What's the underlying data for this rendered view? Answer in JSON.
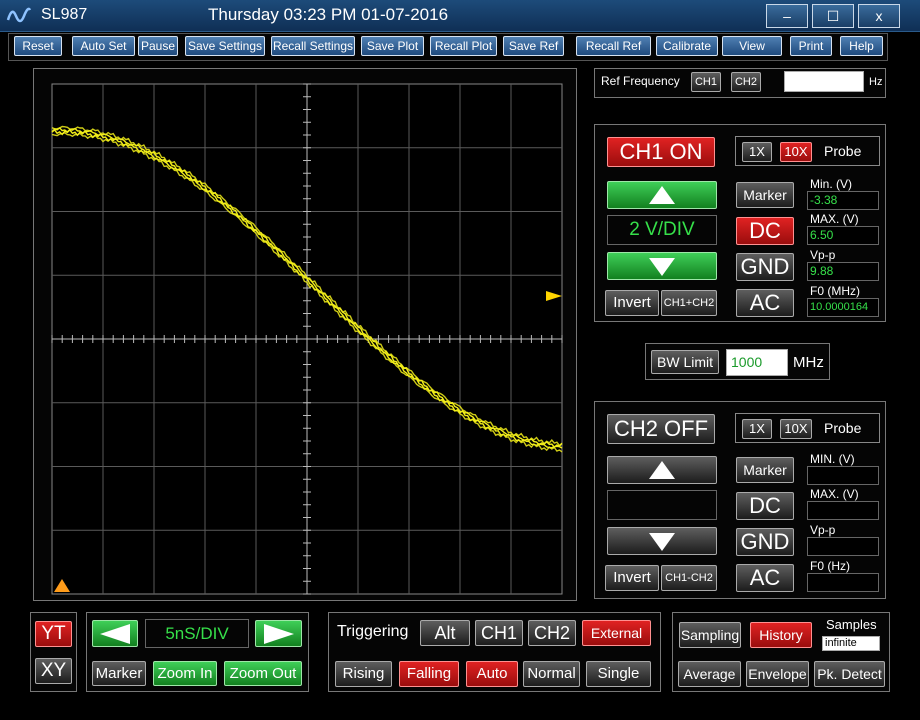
{
  "titlebar": {
    "app_name": "SL987",
    "datetime": "Thursday  03:23 PM   01-07-2016",
    "minimize": "–",
    "maximize": "☐",
    "close": "x"
  },
  "toolbar": [
    "Reset",
    "Auto Set",
    "Pause",
    "Save Settings",
    "Recall Settings",
    "Save Plot",
    "Recall Plot",
    "Save Ref",
    "Recall Ref",
    "Calibrate",
    "View",
    "Print",
    "Help"
  ],
  "ref": {
    "label": "Ref Frequency",
    "ch1": "CH1",
    "ch2": "CH2",
    "value": "",
    "unit": "Hz"
  },
  "ch1": {
    "state": "CH1 ON",
    "probe_1x": "1X",
    "probe_10x": "10X",
    "probe_label": "Probe",
    "volts_div": "2 V/DIV",
    "marker": "Marker",
    "dc": "DC",
    "gnd": "GND",
    "ac": "AC",
    "invert": "Invert",
    "math": "CH1+CH2",
    "min_label": "Min. (V)",
    "min_value": "-3.38",
    "max_label": "MAX. (V)",
    "max_value": "6.50",
    "vpp_label": "Vp-p",
    "vpp_value": "9.88",
    "f0_label": "F0 (MHz)",
    "f0_value": "10.0000164"
  },
  "bw": {
    "label": "BW Limit",
    "value": "1000",
    "unit": "MHz"
  },
  "ch2": {
    "state": "CH2 OFF",
    "probe_1x": "1X",
    "probe_10x": "10X",
    "probe_label": "Probe",
    "volts_div": "",
    "marker": "Marker",
    "dc": "DC",
    "gnd": "GND",
    "ac": "AC",
    "invert": "Invert",
    "math": "CH1-CH2",
    "min_label": "MIN. (V)",
    "min_value": "",
    "max_label": "MAX. (V)",
    "max_value": "",
    "vpp_label": "Vp-p",
    "vpp_value": "",
    "f0_label": "F0 (Hz)",
    "f0_value": ""
  },
  "mode": {
    "yt": "YT",
    "xy": "XY"
  },
  "timebase": {
    "value": "5nS/DIV",
    "marker": "Marker",
    "zoom_in": "Zoom In",
    "zoom_out": "Zoom Out"
  },
  "trigger": {
    "label": "Triggering",
    "alt": "Alt",
    "ch1": "CH1",
    "ch2": "CH2",
    "external": "External",
    "rising": "Rising",
    "falling": "Falling",
    "auto": "Auto",
    "normal": "Normal",
    "single": "Single"
  },
  "acq": {
    "sampling": "Sampling",
    "history": "History",
    "samples_label": "Samples",
    "samples_value": "infinite",
    "average": "Average",
    "envelope": "Envelope",
    "pk_detect": "Pk. Detect"
  },
  "colors": {
    "trace": "#f2ee1a",
    "grid": "#5a5a5a",
    "value_text": "#36e04a",
    "trigger_marker": "#ffd400",
    "ground_marker": "#ff9c1a"
  }
}
